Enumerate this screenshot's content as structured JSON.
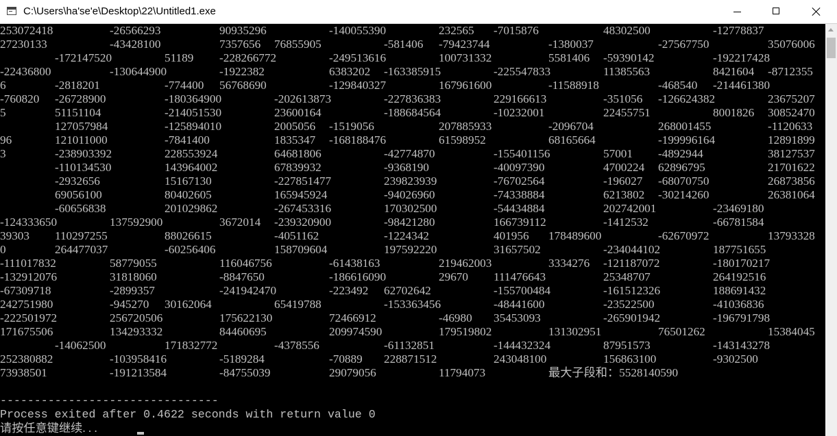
{
  "window": {
    "title": "C:\\Users\\ha'se'e\\Desktop\\22\\Untitled1.exe",
    "icon": "console-app-icon"
  },
  "console": {
    "lines": [
      [
        {
          "c": 0,
          "t": "253072418"
        },
        {
          "c": 2,
          "t": "-26566293"
        },
        {
          "c": 4,
          "t": "90935296"
        },
        {
          "c": 6,
          "t": "-140055390"
        },
        {
          "c": 8,
          "t": "232565"
        },
        {
          "c": 9,
          "t": "-7015876"
        },
        {
          "c": 11,
          "t": "48302500"
        },
        {
          "c": 13,
          "t": "-12778837"
        }
      ],
      [
        {
          "c": 0,
          "t": "27230133"
        },
        {
          "c": 2,
          "t": "-43428100"
        },
        {
          "c": 4,
          "t": "7357656"
        },
        {
          "c": 5,
          "t": "76855905"
        },
        {
          "c": 7,
          "t": "-581406"
        },
        {
          "c": 8,
          "t": "-79423744"
        },
        {
          "c": 10,
          "t": "-1380037"
        },
        {
          "c": 12,
          "t": "-27567750"
        },
        {
          "c": 14,
          "t": "35076006"
        }
      ],
      [
        {
          "c": 1,
          "t": "-172147520"
        },
        {
          "c": 3,
          "t": "51189"
        },
        {
          "c": 4,
          "t": "-228266772"
        },
        {
          "c": 6,
          "t": "-249513616"
        },
        {
          "c": 8,
          "t": "100731332"
        },
        {
          "c": 10,
          "t": "5581406"
        },
        {
          "c": 11,
          "t": "-59390142"
        },
        {
          "c": 13,
          "t": "-192217428"
        }
      ],
      [
        {
          "c": 0,
          "t": "-22436800"
        },
        {
          "c": 2,
          "t": "-130644900"
        },
        {
          "c": 4,
          "t": "-1922382"
        },
        {
          "c": 6,
          "t": "6383202"
        },
        {
          "c": 7,
          "t": "-163385915"
        },
        {
          "c": 9,
          "t": "-225547833"
        },
        {
          "c": 11,
          "t": "11385563"
        },
        {
          "c": 13,
          "t": "8421604"
        },
        {
          "c": 14,
          "t": "-8712355"
        }
      ],
      [
        {
          "c": 0,
          "t": "6"
        },
        {
          "c": 1,
          "t": "-2818201"
        },
        {
          "c": 3,
          "t": "-774400"
        },
        {
          "c": 4,
          "t": "56768690"
        },
        {
          "c": 6,
          "t": "-129840327"
        },
        {
          "c": 8,
          "t": "167961600"
        },
        {
          "c": 10,
          "t": "-11588918"
        },
        {
          "c": 12,
          "t": "-468540"
        },
        {
          "c": 13,
          "t": "-214461380"
        }
      ],
      [
        {
          "c": 0,
          "t": "-760820"
        },
        {
          "c": 1,
          "t": "-26728900"
        },
        {
          "c": 3,
          "t": "-180364900"
        },
        {
          "c": 5,
          "t": "-202613873"
        },
        {
          "c": 7,
          "t": "-227836383"
        },
        {
          "c": 9,
          "t": "229166613"
        },
        {
          "c": 11,
          "t": "-351056"
        },
        {
          "c": 12,
          "t": "-126624382"
        },
        {
          "c": 14,
          "t": "23675207"
        }
      ],
      [
        {
          "c": 0,
          "t": "5"
        },
        {
          "c": 1,
          "t": "51151104"
        },
        {
          "c": 3,
          "t": "-214051530"
        },
        {
          "c": 5,
          "t": "23600164"
        },
        {
          "c": 7,
          "t": "-188684564"
        },
        {
          "c": 9,
          "t": "-10232001"
        },
        {
          "c": 11,
          "t": "22455751"
        },
        {
          "c": 13,
          "t": "8001826"
        },
        {
          "c": 14,
          "t": "30852470"
        }
      ],
      [
        {
          "c": 1,
          "t": "127057984"
        },
        {
          "c": 3,
          "t": "-125894010"
        },
        {
          "c": 5,
          "t": "2005056"
        },
        {
          "c": 6,
          "t": "-1519056"
        },
        {
          "c": 8,
          "t": "207885933"
        },
        {
          "c": 10,
          "t": "-2096704"
        },
        {
          "c": 12,
          "t": "268001455"
        },
        {
          "c": 14,
          "t": "-1120633"
        }
      ],
      [
        {
          "c": 0,
          "t": "96"
        },
        {
          "c": 1,
          "t": "121011000"
        },
        {
          "c": 3,
          "t": "-7841400"
        },
        {
          "c": 5,
          "t": "1835347"
        },
        {
          "c": 6,
          "t": "-168188476"
        },
        {
          "c": 8,
          "t": "61598952"
        },
        {
          "c": 10,
          "t": "68165664"
        },
        {
          "c": 12,
          "t": "-199996164"
        },
        {
          "c": 14,
          "t": "12891899"
        }
      ],
      [
        {
          "c": 0,
          "t": "3"
        },
        {
          "c": 1,
          "t": "-238903392"
        },
        {
          "c": 3,
          "t": "228553924"
        },
        {
          "c": 5,
          "t": "64681806"
        },
        {
          "c": 7,
          "t": "-42774870"
        },
        {
          "c": 9,
          "t": "-155401156"
        },
        {
          "c": 11,
          "t": "57001"
        },
        {
          "c": 12,
          "t": "-4892944"
        },
        {
          "c": 14,
          "t": "38127537"
        }
      ],
      [
        {
          "c": 1,
          "t": "-110134530"
        },
        {
          "c": 3,
          "t": "143964002"
        },
        {
          "c": 5,
          "t": "67839932"
        },
        {
          "c": 7,
          "t": "-9368190"
        },
        {
          "c": 9,
          "t": "-40097390"
        },
        {
          "c": 11,
          "t": "4700224"
        },
        {
          "c": 12,
          "t": "62896795"
        },
        {
          "c": 14,
          "t": "21701622"
        }
      ],
      [
        {
          "c": 1,
          "t": "-2932656"
        },
        {
          "c": 3,
          "t": "15167130"
        },
        {
          "c": 5,
          "t": "-227851477"
        },
        {
          "c": 7,
          "t": "239823939"
        },
        {
          "c": 9,
          "t": "-76702564"
        },
        {
          "c": 11,
          "t": "-196027"
        },
        {
          "c": 12,
          "t": "-68070750"
        },
        {
          "c": 14,
          "t": "26873856"
        }
      ],
      [
        {
          "c": 1,
          "t": "69056100"
        },
        {
          "c": 3,
          "t": "80402605"
        },
        {
          "c": 5,
          "t": "165945924"
        },
        {
          "c": 7,
          "t": "-94026960"
        },
        {
          "c": 9,
          "t": "-74338884"
        },
        {
          "c": 11,
          "t": "6213802"
        },
        {
          "c": 12,
          "t": "-30214260"
        },
        {
          "c": 14,
          "t": "26381064"
        }
      ],
      [
        {
          "c": 1,
          "t": "-60656838"
        },
        {
          "c": 3,
          "t": "201029862"
        },
        {
          "c": 5,
          "t": "-267453316"
        },
        {
          "c": 7,
          "t": "170302500"
        },
        {
          "c": 9,
          "t": "-54434884"
        },
        {
          "c": 11,
          "t": "202742001"
        },
        {
          "c": 13,
          "t": "-23469180"
        }
      ],
      [
        {
          "c": 0,
          "t": "-124333650"
        },
        {
          "c": 2,
          "t": "137592900"
        },
        {
          "c": 4,
          "t": "3672014"
        },
        {
          "c": 5,
          "t": "-239320900"
        },
        {
          "c": 7,
          "t": "-98421280"
        },
        {
          "c": 9,
          "t": "166739112"
        },
        {
          "c": 11,
          "t": "-1412532"
        },
        {
          "c": 13,
          "t": "-66781584"
        }
      ],
      [
        {
          "c": 0,
          "t": "39303"
        },
        {
          "c": 1,
          "t": "110297255"
        },
        {
          "c": 3,
          "t": "88026615"
        },
        {
          "c": 5,
          "t": "-4051162"
        },
        {
          "c": 7,
          "t": "-1224342"
        },
        {
          "c": 9,
          "t": "401956"
        },
        {
          "c": 10,
          "t": "178489600"
        },
        {
          "c": 12,
          "t": "-62670972"
        },
        {
          "c": 14,
          "t": "13793328"
        }
      ],
      [
        {
          "c": 0,
          "t": "0"
        },
        {
          "c": 1,
          "t": "264477037"
        },
        {
          "c": 3,
          "t": "-60256406"
        },
        {
          "c": 5,
          "t": "158709604"
        },
        {
          "c": 7,
          "t": "197592220"
        },
        {
          "c": 9,
          "t": "31657502"
        },
        {
          "c": 11,
          "t": "-234044102"
        },
        {
          "c": 13,
          "t": "187751655"
        }
      ],
      [
        {
          "c": 0,
          "t": "-111017832"
        },
        {
          "c": 2,
          "t": "58779055"
        },
        {
          "c": 4,
          "t": "116046756"
        },
        {
          "c": 6,
          "t": "-61438163"
        },
        {
          "c": 8,
          "t": "219462003"
        },
        {
          "c": 10,
          "t": "3334276"
        },
        {
          "c": 11,
          "t": "-121187072"
        },
        {
          "c": 13,
          "t": "-180170217"
        }
      ],
      [
        {
          "c": 0,
          "t": "-132912076"
        },
        {
          "c": 2,
          "t": "31818060"
        },
        {
          "c": 4,
          "t": "-8847650"
        },
        {
          "c": 6,
          "t": "-186616090"
        },
        {
          "c": 8,
          "t": "29670"
        },
        {
          "c": 9,
          "t": "111476643"
        },
        {
          "c": 11,
          "t": "25348707"
        },
        {
          "c": 13,
          "t": "264192516"
        }
      ],
      [
        {
          "c": 0,
          "t": "-67309718"
        },
        {
          "c": 2,
          "t": "-2899357"
        },
        {
          "c": 4,
          "t": "-241942470"
        },
        {
          "c": 6,
          "t": "-223492"
        },
        {
          "c": 7,
          "t": "62702642"
        },
        {
          "c": 9,
          "t": "-155700484"
        },
        {
          "c": 11,
          "t": "-161512326"
        },
        {
          "c": 13,
          "t": "188691432"
        }
      ],
      [
        {
          "c": 0,
          "t": "242751980"
        },
        {
          "c": 2,
          "t": "-945270"
        },
        {
          "c": 3,
          "t": "30162064"
        },
        {
          "c": 5,
          "t": "65419788"
        },
        {
          "c": 7,
          "t": "-153363456"
        },
        {
          "c": 9,
          "t": "-48441600"
        },
        {
          "c": 11,
          "t": "-23522500"
        },
        {
          "c": 13,
          "t": "-41036836"
        }
      ],
      [
        {
          "c": 0,
          "t": "-222501972"
        },
        {
          "c": 2,
          "t": "256720506"
        },
        {
          "c": 4,
          "t": "175622130"
        },
        {
          "c": 6,
          "t": "72466912"
        },
        {
          "c": 8,
          "t": "-46980"
        },
        {
          "c": 9,
          "t": "35453093"
        },
        {
          "c": 11,
          "t": "-265901942"
        },
        {
          "c": 13,
          "t": "-196791798"
        }
      ],
      [
        {
          "c": 0,
          "t": "171675506"
        },
        {
          "c": 2,
          "t": "134293332"
        },
        {
          "c": 4,
          "t": "84460695"
        },
        {
          "c": 6,
          "t": "209974590"
        },
        {
          "c": 8,
          "t": "179519802"
        },
        {
          "c": 10,
          "t": "131302951"
        },
        {
          "c": 12,
          "t": "76501262"
        },
        {
          "c": 14,
          "t": "15384045"
        }
      ],
      [
        {
          "c": 1,
          "t": "-14062500"
        },
        {
          "c": 3,
          "t": "171832772"
        },
        {
          "c": 5,
          "t": "-4378556"
        },
        {
          "c": 7,
          "t": "-61132851"
        },
        {
          "c": 9,
          "t": "-144432324"
        },
        {
          "c": 11,
          "t": "87951573"
        },
        {
          "c": 13,
          "t": "-143143278"
        }
      ],
      [
        {
          "c": 0,
          "t": "252380882"
        },
        {
          "c": 2,
          "t": "-103958416"
        },
        {
          "c": 4,
          "t": "-5189284"
        },
        {
          "c": 6,
          "t": "-70889"
        },
        {
          "c": 7,
          "t": "228871512"
        },
        {
          "c": 9,
          "t": "243048100"
        },
        {
          "c": 11,
          "t": "156863100"
        },
        {
          "c": 13,
          "t": "-9302500"
        }
      ],
      [
        {
          "c": 0,
          "t": "73938501"
        },
        {
          "c": 2,
          "t": "-191213584"
        },
        {
          "c": 4,
          "t": "-84755039"
        },
        {
          "c": 6,
          "t": "29079056"
        },
        {
          "c": 8,
          "t": "11794073"
        },
        {
          "c": 10,
          "t": "最大子段和：5528140590"
        }
      ]
    ],
    "separator": "--------------------------------",
    "status": "Process exited after 0.4622 seconds with return value 0",
    "prompt": "请按任意键继续. . ."
  },
  "colors": {
    "console_bg": "#000000",
    "console_fg": "#c0c0c0",
    "titlebar_bg": "#ffffff",
    "scrollbar_bg": "#f0f0f0"
  },
  "icons": {
    "minimize": "minimize-icon",
    "maximize": "maximize-icon",
    "close": "close-icon",
    "scroll_up": "scroll-up-arrow-icon"
  }
}
